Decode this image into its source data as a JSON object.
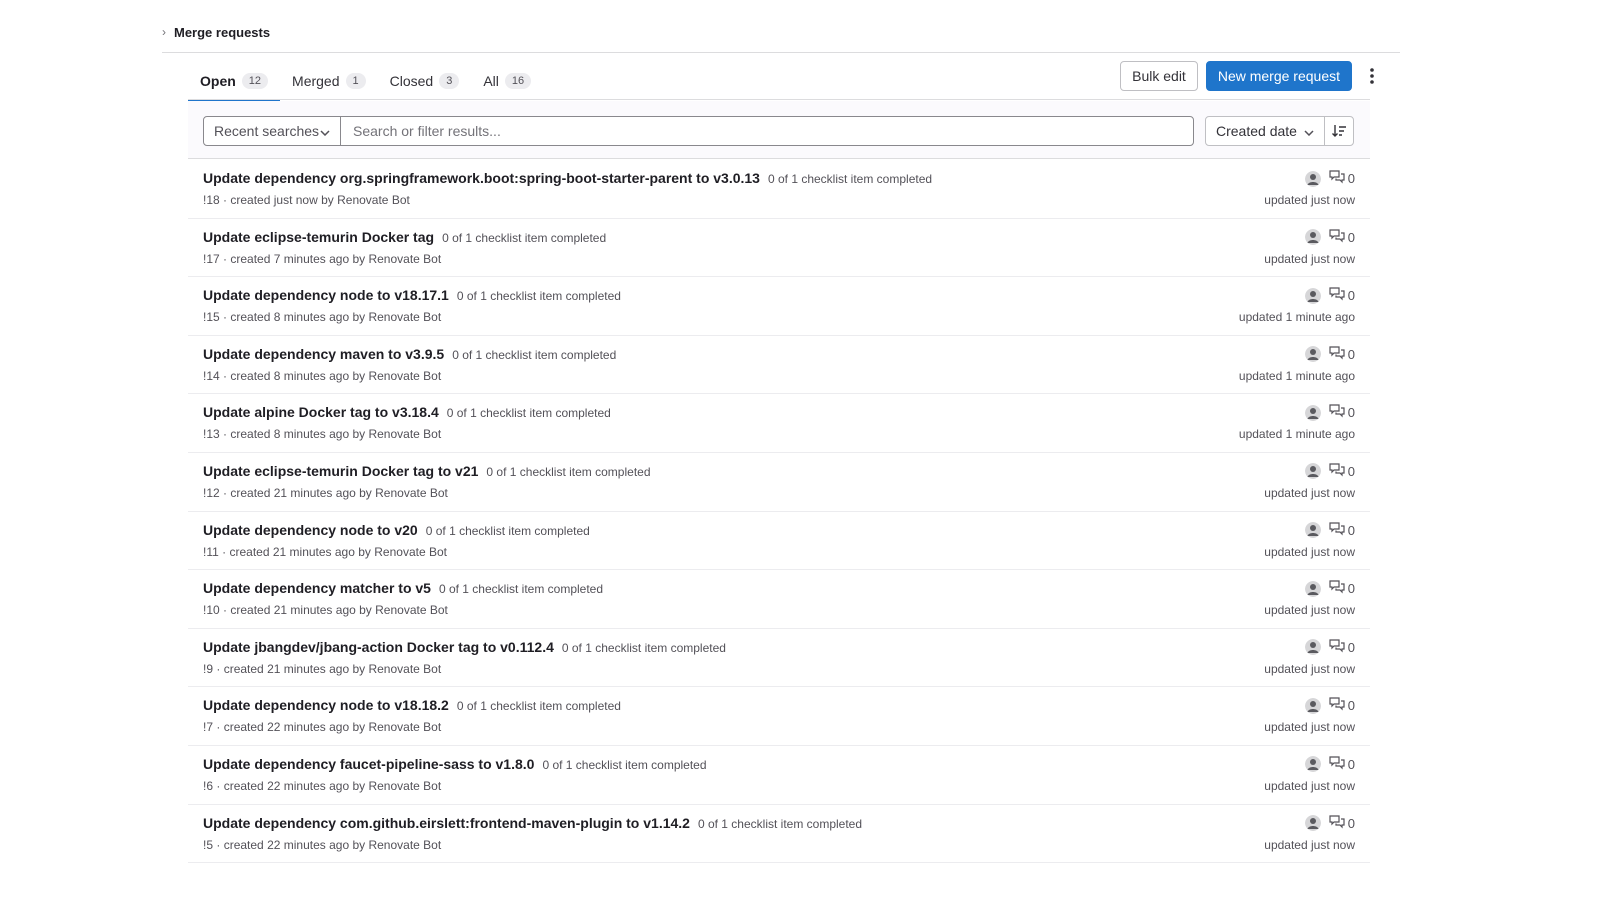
{
  "breadcrumb": {
    "label": "Merge requests"
  },
  "tabs": [
    {
      "label": "Open",
      "count": "12"
    },
    {
      "label": "Merged",
      "count": "1"
    },
    {
      "label": "Closed",
      "count": "3"
    },
    {
      "label": "All",
      "count": "16"
    }
  ],
  "actions": {
    "bulk_edit": "Bulk edit",
    "new_mr": "New merge request"
  },
  "filter": {
    "recent_searches": "Recent searches",
    "search_placeholder": "Search or filter results...",
    "sort_by": "Created date"
  },
  "colors": {
    "primary": "#1f75cb",
    "active_tab_underline": "#1f75cb"
  },
  "merge_requests": [
    {
      "title": "Update dependency org.springframework.boot:spring-boot-starter-parent to v3.0.13",
      "checklist": "0 of 1 checklist item completed",
      "iid": "!18",
      "created": "created just now by",
      "author": "Renovate Bot",
      "comments": "0",
      "updated": "updated just now"
    },
    {
      "title": "Update eclipse-temurin Docker tag",
      "checklist": "0 of 1 checklist item completed",
      "iid": "!17",
      "created": "created 7 minutes ago by",
      "author": "Renovate Bot",
      "comments": "0",
      "updated": "updated just now"
    },
    {
      "title": "Update dependency node to v18.17.1",
      "checklist": "0 of 1 checklist item completed",
      "iid": "!15",
      "created": "created 8 minutes ago by",
      "author": "Renovate Bot",
      "comments": "0",
      "updated": "updated 1 minute ago"
    },
    {
      "title": "Update dependency maven to v3.9.5",
      "checklist": "0 of 1 checklist item completed",
      "iid": "!14",
      "created": "created 8 minutes ago by",
      "author": "Renovate Bot",
      "comments": "0",
      "updated": "updated 1 minute ago"
    },
    {
      "title": "Update alpine Docker tag to v3.18.4",
      "checklist": "0 of 1 checklist item completed",
      "iid": "!13",
      "created": "created 8 minutes ago by",
      "author": "Renovate Bot",
      "comments": "0",
      "updated": "updated 1 minute ago"
    },
    {
      "title": "Update eclipse-temurin Docker tag to v21",
      "checklist": "0 of 1 checklist item completed",
      "iid": "!12",
      "created": "created 21 minutes ago by",
      "author": "Renovate Bot",
      "comments": "0",
      "updated": "updated just now"
    },
    {
      "title": "Update dependency node to v20",
      "checklist": "0 of 1 checklist item completed",
      "iid": "!11",
      "created": "created 21 minutes ago by",
      "author": "Renovate Bot",
      "comments": "0",
      "updated": "updated just now"
    },
    {
      "title": "Update dependency matcher to v5",
      "checklist": "0 of 1 checklist item completed",
      "iid": "!10",
      "created": "created 21 minutes ago by",
      "author": "Renovate Bot",
      "comments": "0",
      "updated": "updated just now"
    },
    {
      "title": "Update jbangdev/jbang-action Docker tag to v0.112.4",
      "checklist": "0 of 1 checklist item completed",
      "iid": "!9",
      "created": "created 21 minutes ago by",
      "author": "Renovate Bot",
      "comments": "0",
      "updated": "updated just now"
    },
    {
      "title": "Update dependency node to v18.18.2",
      "checklist": "0 of 1 checklist item completed",
      "iid": "!7",
      "created": "created 22 minutes ago by",
      "author": "Renovate Bot",
      "comments": "0",
      "updated": "updated just now"
    },
    {
      "title": "Update dependency faucet-pipeline-sass to v1.8.0",
      "checklist": "0 of 1 checklist item completed",
      "iid": "!6",
      "created": "created 22 minutes ago by",
      "author": "Renovate Bot",
      "comments": "0",
      "updated": "updated just now"
    },
    {
      "title": "Update dependency com.github.eirslett:frontend-maven-plugin to v1.14.2",
      "checklist": "0 of 1 checklist item completed",
      "iid": "!5",
      "created": "created 22 minutes ago by",
      "author": "Renovate Bot",
      "comments": "0",
      "updated": "updated just now"
    }
  ]
}
